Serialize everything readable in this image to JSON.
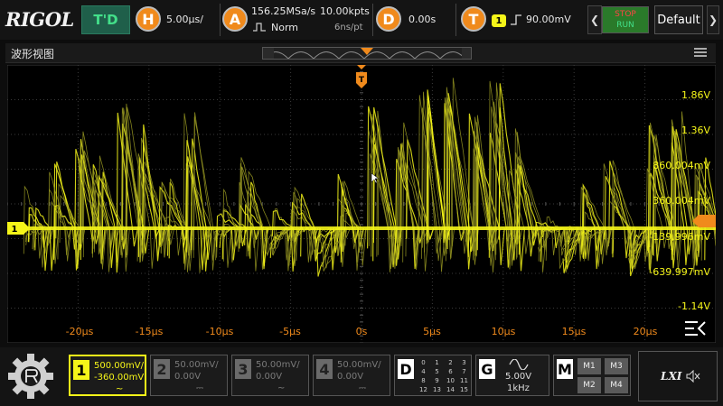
{
  "colors": {
    "accent": "#f08a1c",
    "ch1": "#f5f519",
    "ch1_dim": "#9a9a22",
    "grid": "#3a3a3a",
    "run_green": "#43e08a",
    "stop_red": "#ff4444"
  },
  "topbar": {
    "logo": "RIGOL",
    "mode": "T'D",
    "horizontal": {
      "icon": "H",
      "timebase": "5.00μs/"
    },
    "acquire": {
      "icon": "A",
      "sample_rate": "156.25MSa/s",
      "points": "10.00kpts",
      "mode": "Norm",
      "resolution": "6ns/pt"
    },
    "delay": {
      "icon": "D",
      "value": "0.00s"
    },
    "trigger": {
      "icon": "T",
      "source": "1",
      "slope_icon": "rising-edge-icon",
      "level": "90.00mV"
    },
    "stop": "STOP",
    "run": "RUN",
    "default": "Default"
  },
  "waveform_window": {
    "title": "波形视图",
    "trigger_marker": "T",
    "ch1_marker": "1"
  },
  "voltage_labels": [
    "1.86V",
    "1.36V",
    "860.004mV",
    "360.004mV",
    "-139.996mV",
    "-639.997mV",
    "-1.14V"
  ],
  "time_labels": [
    "-20μs",
    "-15μs",
    "-10μs",
    "-5μs",
    "0s",
    "5μs",
    "10μs",
    "15μs",
    "20μs"
  ],
  "channels": [
    {
      "num": "1",
      "scale": "500.00mV/",
      "offset": "-360.00mV",
      "coupling": "~",
      "active": true
    },
    {
      "num": "2",
      "scale": "50.00mV/",
      "offset": "0.00V",
      "coupling": "⎓",
      "active": false
    },
    {
      "num": "3",
      "scale": "50.00mV/",
      "offset": "0.00V",
      "coupling": "~",
      "active": false
    },
    {
      "num": "4",
      "scale": "50.00mV/",
      "offset": "0.00V",
      "coupling": "⎓",
      "active": false
    }
  ],
  "digital": {
    "label": "D",
    "numbers": [
      "0",
      "1",
      "2",
      "3",
      "4",
      "5",
      "6",
      "7",
      "8",
      "9",
      "10",
      "11",
      "12",
      "13",
      "14",
      "15"
    ]
  },
  "generator": {
    "label": "G",
    "amplitude": "5.00V",
    "frequency": "1kHz"
  },
  "math": {
    "label": "M",
    "buttons": [
      "M1",
      "M3",
      "M2",
      "M4"
    ]
  },
  "status": {
    "lxi": "LXI"
  }
}
